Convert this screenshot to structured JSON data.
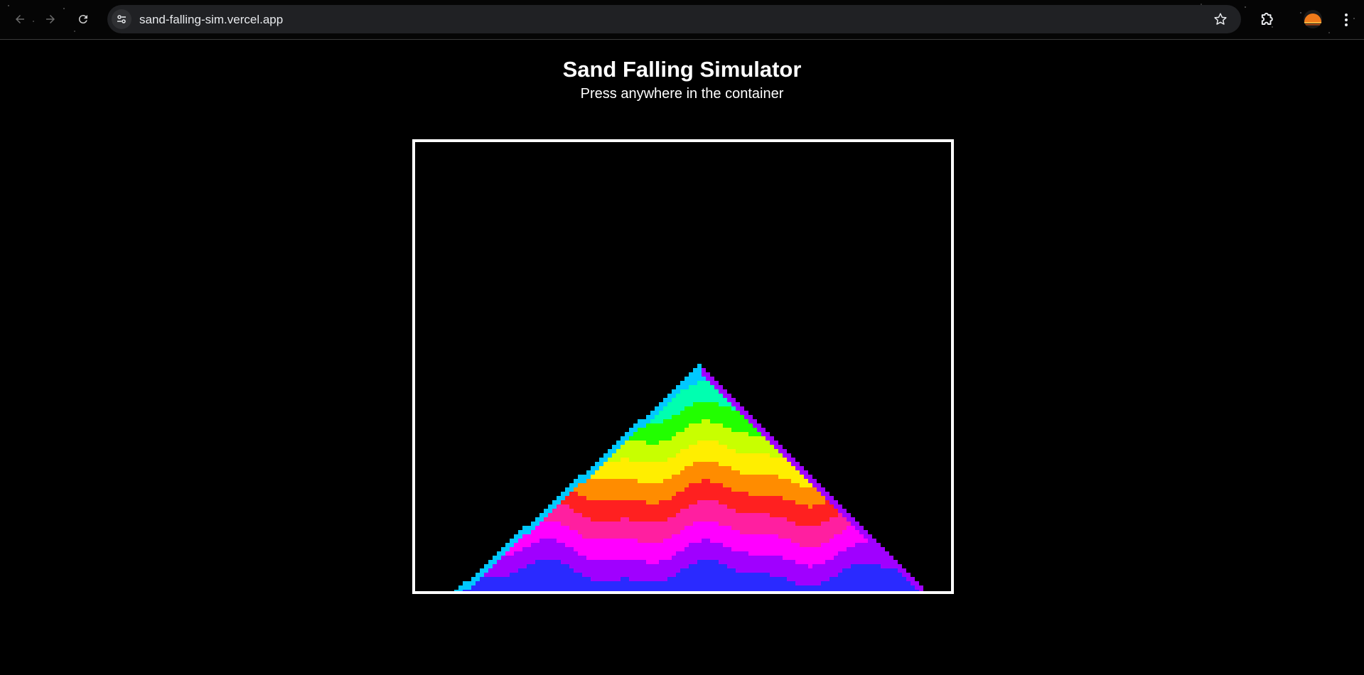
{
  "browser": {
    "url": "sand-falling-sim.vercel.app",
    "back_icon": "arrow-left-icon",
    "forward_icon": "arrow-right-icon",
    "reload_icon": "reload-icon",
    "site_info_icon": "tune-icon",
    "bookmark_icon": "star-icon",
    "extensions_icon": "puzzle-icon",
    "menu_icon": "kebab-icon"
  },
  "page": {
    "title": "Sand Falling Simulator",
    "subtitle": "Press anywhere in the container"
  },
  "colors": {
    "background": "#000000",
    "container_border": "#ffffff",
    "sand_palette": [
      "#1b8cff",
      "#00c8ff",
      "#00ffb0",
      "#22ff00",
      "#c8ff00",
      "#ffee00",
      "#ff8c00",
      "#ff2020",
      "#ff1fa0",
      "#ff00ff",
      "#a000ff",
      "#2a2aff"
    ]
  }
}
